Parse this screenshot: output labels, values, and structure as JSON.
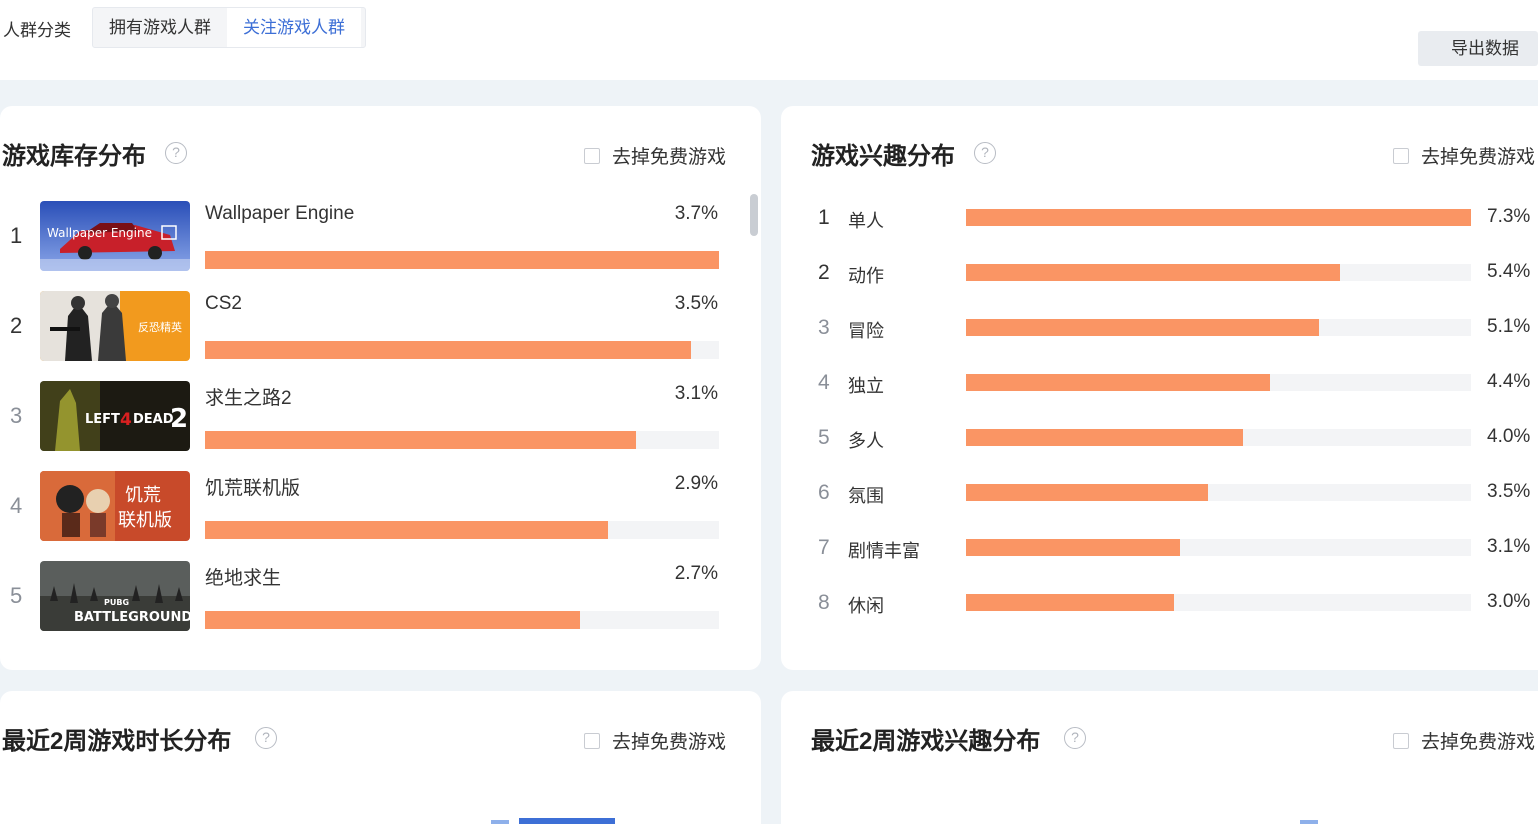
{
  "header": {
    "crowd_label": "人群分类",
    "tabs": [
      {
        "label": "拥有游戏人群",
        "active": false
      },
      {
        "label": "关注游戏人群",
        "active": true
      }
    ],
    "export_label": "导出数据"
  },
  "colors": {
    "bar": "#fa9564",
    "accent": "#3d6fd6"
  },
  "library": {
    "title": "游戏库存分布",
    "help_icon": "question-circle-icon",
    "free_toggle": "去掉免费游戏",
    "items": [
      {
        "rank": "1",
        "name": "Wallpaper Engine",
        "pct": "3.7%",
        "value": 3.7
      },
      {
        "rank": "2",
        "name": "CS2",
        "pct": "3.5%",
        "value": 3.5
      },
      {
        "rank": "3",
        "name": "求生之路2",
        "pct": "3.1%",
        "value": 3.1
      },
      {
        "rank": "4",
        "name": "饥荒联机版",
        "pct": "2.9%",
        "value": 2.9
      },
      {
        "rank": "5",
        "name": "绝地求生",
        "pct": "2.7%",
        "value": 2.7
      }
    ]
  },
  "interest": {
    "title": "游戏兴趣分布",
    "help_icon": "question-circle-icon",
    "free_toggle": "去掉免费游戏",
    "items": [
      {
        "rank": "1",
        "name": "单人",
        "pct": "7.3%",
        "value": 7.3
      },
      {
        "rank": "2",
        "name": "动作",
        "pct": "5.4%",
        "value": 5.4
      },
      {
        "rank": "3",
        "name": "冒险",
        "pct": "5.1%",
        "value": 5.1
      },
      {
        "rank": "4",
        "name": "独立",
        "pct": "4.4%",
        "value": 4.4
      },
      {
        "rank": "5",
        "name": "多人",
        "pct": "4.0%",
        "value": 4.0
      },
      {
        "rank": "6",
        "name": "氛围",
        "pct": "3.5%",
        "value": 3.5
      },
      {
        "rank": "7",
        "name": "剧情丰富",
        "pct": "3.1%",
        "value": 3.1
      },
      {
        "rank": "8",
        "name": "休闲",
        "pct": "3.0%",
        "value": 3.0
      }
    ]
  },
  "playtime": {
    "title": "最近2周游戏时长分布",
    "help_icon": "question-circle-icon",
    "free_toggle": "去掉免费游戏"
  },
  "recent_interest": {
    "title": "最近2周游戏兴趣分布",
    "help_icon": "question-circle-icon",
    "free_toggle": "去掉免费游戏"
  }
}
